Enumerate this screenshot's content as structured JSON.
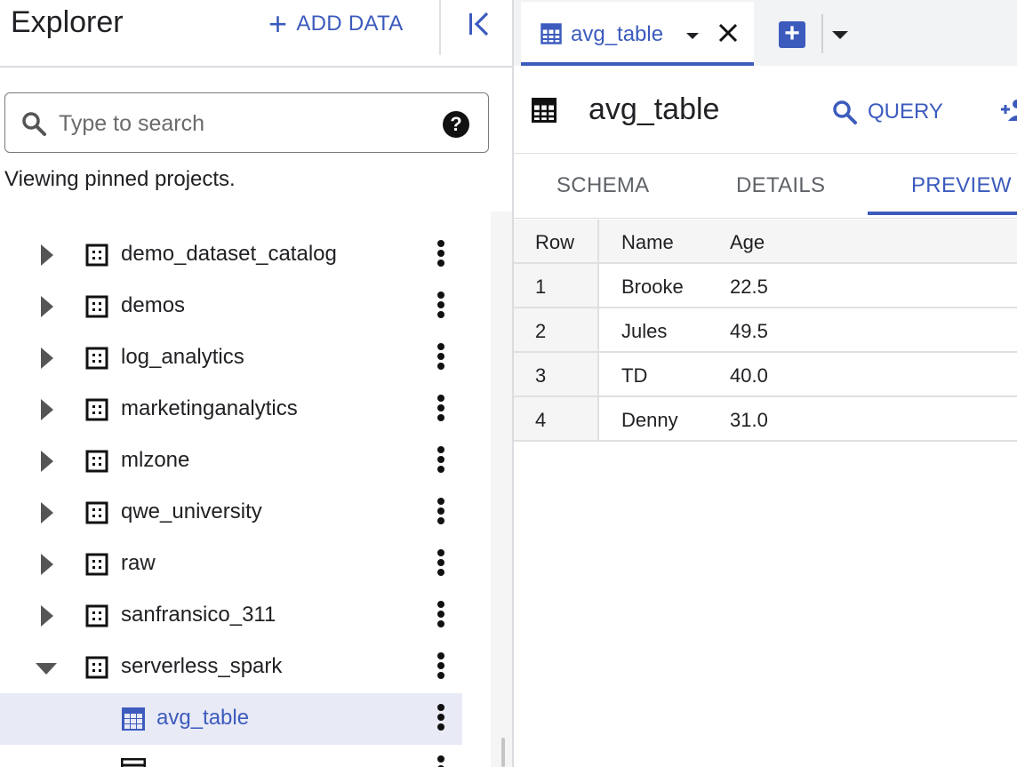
{
  "explorer": {
    "title": "Explorer",
    "add_data_label": "ADD DATA",
    "search": {
      "placeholder": "Type to search",
      "value": ""
    },
    "viewing_text": "Viewing pinned projects.",
    "tree": [
      {
        "label": "demo_dataset_catalog",
        "expanded": false
      },
      {
        "label": "demos",
        "expanded": false
      },
      {
        "label": "log_analytics",
        "expanded": false
      },
      {
        "label": "marketinganalytics",
        "expanded": false
      },
      {
        "label": "mlzone",
        "expanded": false
      },
      {
        "label": "qwe_university",
        "expanded": false
      },
      {
        "label": "raw",
        "expanded": false
      },
      {
        "label": "sanfransico_311",
        "expanded": false
      },
      {
        "label": "serverless_spark",
        "expanded": true
      },
      {
        "label": "avg_table",
        "selected": true,
        "child": true
      }
    ]
  },
  "tab": {
    "label": "avg_table"
  },
  "table_view": {
    "title": "avg_table",
    "query_label": "QUERY",
    "subtabs": [
      "SCHEMA",
      "DETAILS",
      "PREVIEW"
    ],
    "active_subtab": "PREVIEW"
  },
  "preview": {
    "columns": [
      "Row",
      "Name",
      "Age"
    ],
    "rows": [
      [
        "1",
        "Brooke",
        "22.5"
      ],
      [
        "2",
        "Jules",
        "49.5"
      ],
      [
        "3",
        "TD",
        "40.0"
      ],
      [
        "4",
        "Denny",
        "31.0"
      ]
    ]
  },
  "colors": {
    "accent": "#3c5bbd",
    "selected_bg": "#e8eaf6",
    "text": "#202124"
  }
}
